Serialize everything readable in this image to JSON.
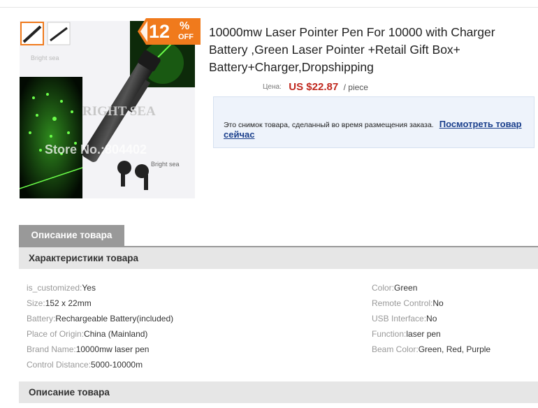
{
  "product": {
    "title": "10000mw Laser Pointer Pen For 10000 with Charger Battery ,Green Laser Pointer +Retail Gift Box+ Battery+Charger,Dropshipping",
    "image_watermark_store": "Store No.:804402",
    "image_watermark_brand": "Bright sea",
    "image_watermark_brand_big": "RIGHT SEA"
  },
  "badge": {
    "percent": "12",
    "percent_sign": "%",
    "off": "OFF"
  },
  "price": {
    "label": "Цена:",
    "value": "US $22.87",
    "unit": "/ piece"
  },
  "notice": {
    "text": "Это снимок товара, сделанный во время размещения заказа.",
    "link": "Посмотреть товар сейчас"
  },
  "tabs": {
    "description": "Описание товара"
  },
  "sections": {
    "characteristics": "Характеристики товара",
    "description": "Описание товара"
  },
  "attributes_left": [
    {
      "name": "is_customized:",
      "value": "Yes"
    },
    {
      "name": "Size:",
      "value": "152 x 22mm"
    },
    {
      "name": "Battery:",
      "value": "Rechargeable Battery(included)"
    },
    {
      "name": "Place of Origin:",
      "value": "China (Mainland)"
    },
    {
      "name": "Brand Name:",
      "value": "10000mw laser pen"
    },
    {
      "name": "Control Distance:",
      "value": "5000-10000m"
    }
  ],
  "attributes_right": [
    {
      "name": "Color:",
      "value": "Green"
    },
    {
      "name": "Remote Control:",
      "value": "No"
    },
    {
      "name": "USB Interface:",
      "value": "No"
    },
    {
      "name": "Function:",
      "value": "laser pen"
    },
    {
      "name": "Beam Color:",
      "value": "Green, Red, Purple"
    }
  ],
  "colors": {
    "accent_orange": "#f07a1c",
    "price_red": "#c0281e",
    "link_blue": "#1a3f8c",
    "tab_gray": "#999999",
    "laser_green": "#39d12f"
  }
}
